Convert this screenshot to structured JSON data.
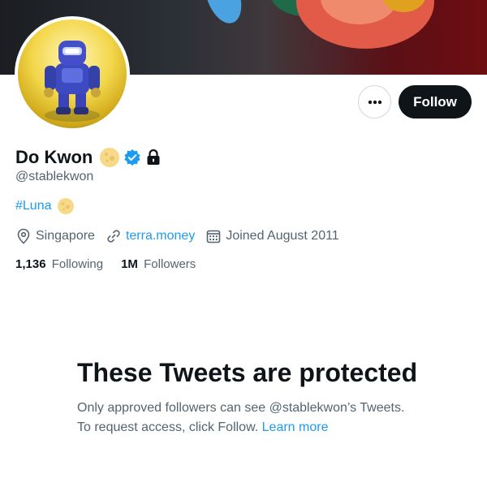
{
  "profile": {
    "name": "Do Kwon",
    "handle": "@stablekwon",
    "bio": "#Luna",
    "location": "Singapore",
    "website": "terra.money",
    "joined": "Joined August 2011"
  },
  "stats": {
    "following_count": "1,136",
    "following_label": "Following",
    "followers_count": "1M",
    "followers_label": "Followers"
  },
  "actions": {
    "more_label": "•••",
    "follow_label": "Follow"
  },
  "protected": {
    "title": "These Tweets are protected",
    "text": "Only approved followers can see @stablekwon’s Tweets. To request access, click Follow.",
    "learn_more": "Learn more"
  },
  "colors": {
    "accent": "#1d9bf0",
    "text_primary": "#0f1419",
    "text_secondary": "#536471",
    "moon": "#f6d77a",
    "verified": "#1d9bf0"
  },
  "icons": {
    "verified": "verified-badge-icon",
    "lock": "lock-icon",
    "moon": "moon-emoji-icon",
    "location": "location-pin-icon",
    "link": "link-icon",
    "calendar": "calendar-icon",
    "more": "more-dots-icon"
  }
}
